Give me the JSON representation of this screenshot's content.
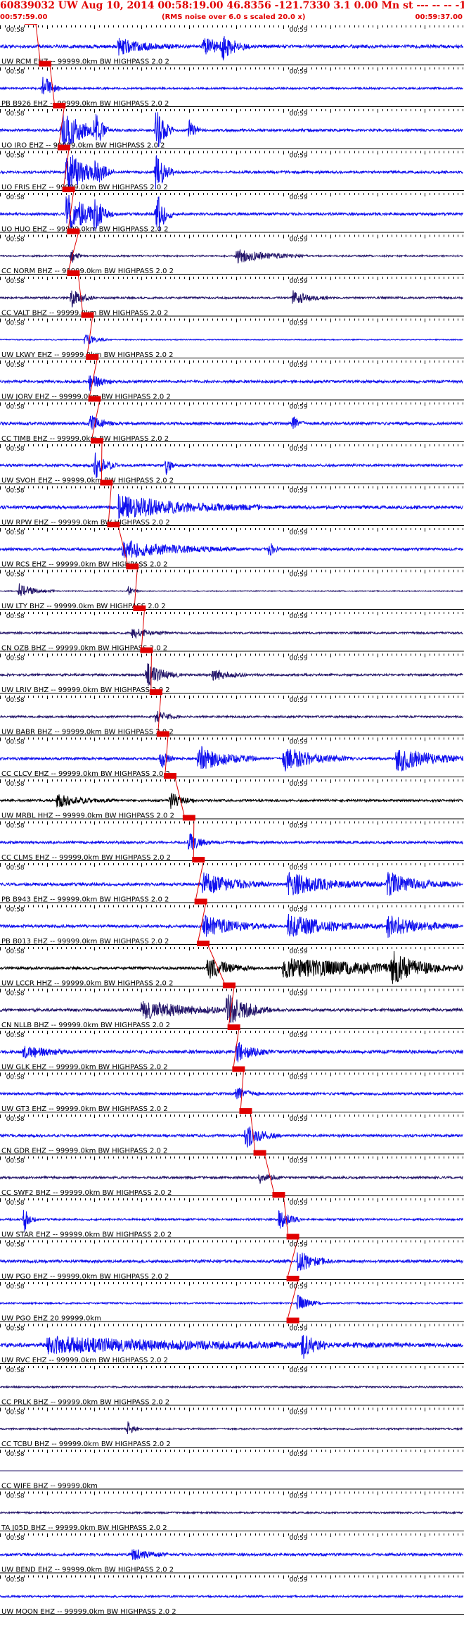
{
  "header": {
    "title": "60839032 UW Aug 10, 2014 00:58:19.00   46.8356 -121.7330  3.1 0.00 Mn st --- -- --  -1",
    "start_time": "00:57:59.00",
    "noise_note": "(RMS noise over 6.0 s scaled 20.0 x)",
    "end_time": "00:59:37.00"
  },
  "chart_data": {
    "type": "line",
    "title": "60839032 UW Aug 10, 2014 00:58:19.00   46.8356 -121.7330  3.1 0.00 Mn st --- -- --  -1",
    "x_range_seconds": [
      0,
      98
    ],
    "x_tick_labels": [
      "00:58",
      "00:59"
    ],
    "x_tick_seconds": [
      1,
      61
    ],
    "colors": {
      "red": "#e00000",
      "blue": "#1010ee",
      "navy": "#24166a",
      "black": "#000000"
    },
    "traces": [
      {
        "label": "UW RCM EHZ -- 99999.0km BW  HIGHPASS  2.0  2",
        "color": "blue",
        "pick_s": 5.5,
        "energy": 1.0,
        "bursts": [
          [
            25,
            5,
            1.4
          ],
          [
            43,
            4,
            1.6
          ],
          [
            47,
            2,
            2.0
          ]
        ]
      },
      {
        "label": "PB B926 EHZ -- 99999.0km BW  HIGHPASS  2.0  2",
        "color": "blue",
        "pick_s": 8.5,
        "energy": 0.6,
        "bursts": [
          [
            9,
            1.5,
            3.0
          ]
        ]
      },
      {
        "label": "UO IRO EHZ -- 99999.0km BW  HIGHPASS  2.0  2",
        "color": "blue",
        "pick_s": 11.5,
        "energy": 0.8,
        "bursts": [
          [
            13,
            4,
            4.0
          ],
          [
            20,
            1,
            3.5
          ],
          [
            33,
            1.5,
            4.5
          ],
          [
            40,
            1,
            2.0
          ]
        ]
      },
      {
        "label": "UO FRIS EHZ -- 99999.0km BW  HIGHPASS  2.0  2",
        "color": "blue",
        "pick_s": 12.5,
        "energy": 0.8,
        "bursts": [
          [
            14,
            4,
            4.0
          ],
          [
            20,
            1,
            3.0
          ],
          [
            33,
            1.5,
            4.5
          ]
        ]
      },
      {
        "label": "UO HUO EHZ -- 99999.0km BW  HIGHPASS  2.0  2",
        "color": "blue",
        "pick_s": 13.5,
        "energy": 0.8,
        "bursts": [
          [
            14,
            4,
            4.0
          ],
          [
            20,
            1,
            3.0
          ],
          [
            33,
            1.5,
            4.5
          ]
        ]
      },
      {
        "label": "CC NORM BHZ -- 99999.0km BW  HIGHPASS  2.0  2",
        "color": "navy",
        "pick_s": 14.5,
        "energy": 0.5,
        "bursts": [
          [
            15,
            1,
            1.5
          ],
          [
            50,
            6,
            1.3
          ]
        ]
      },
      {
        "label": "CC VALT BHZ -- 99999.0km BW  HIGHPASS  2.0  2",
        "color": "navy",
        "pick_s": 14.5,
        "energy": 0.6,
        "bursts": [
          [
            15,
            2,
            1.8
          ],
          [
            62,
            3,
            1.4
          ]
        ]
      },
      {
        "label": "UW LKWY EHZ -- 99999.0km BW  HIGHPASS  2.0  2",
        "color": "blue",
        "pick_s": 17.5,
        "energy": 0.3,
        "bursts": [
          [
            18,
            2,
            1.2
          ]
        ]
      },
      {
        "label": "UW JORV EHZ -- 99999.0km BW  HIGHPASS  2.0  2",
        "color": "blue",
        "pick_s": 18.5,
        "energy": 0.8,
        "bursts": [
          [
            19,
            2,
            1.5
          ]
        ]
      },
      {
        "label": "CC TIMB EHZ -- 99999.0km BW  HIGHPASS  2.0  2",
        "color": "blue",
        "pick_s": 19.0,
        "energy": 0.9,
        "bursts": [
          [
            19,
            2,
            1.6
          ],
          [
            62,
            1,
            1.5
          ]
        ]
      },
      {
        "label": "UW SVOH EHZ -- 99999.0km BW  HIGHPASS  2.0  2",
        "color": "blue",
        "pick_s": 19.5,
        "energy": 0.8,
        "bursts": [
          [
            20,
            2,
            2.5
          ],
          [
            35,
            1,
            1.8
          ]
        ]
      },
      {
        "label": "UW RPW EHZ -- 99999.0km BW  HIGHPASS  2.0  2",
        "color": "blue",
        "pick_s": 21.5,
        "energy": 1.0,
        "bursts": [
          [
            25,
            12,
            2.2
          ]
        ]
      },
      {
        "label": "UW RCS EHZ -- 99999.0km BW  HIGHPASS  2.0  2",
        "color": "blue",
        "pick_s": 23.0,
        "energy": 0.8,
        "bursts": [
          [
            26,
            10,
            1.6
          ],
          [
            57,
            1,
            1.4
          ]
        ]
      },
      {
        "label": "UW LTY BHZ -- 99999.0km BW  HIGHPASS  2.0  2",
        "color": "navy",
        "pick_s": 27.0,
        "energy": 0.3,
        "bursts": [
          [
            4,
            3,
            1.3
          ],
          [
            27,
            1,
            1.0
          ]
        ]
      },
      {
        "label": "CN OZB BHZ -- 99999.0km BW  HIGHPASS  2.0  2",
        "color": "navy",
        "pick_s": 28.5,
        "energy": 0.6,
        "bursts": [
          [
            28,
            3,
            1.0
          ]
        ]
      },
      {
        "label": "UW LRIV BHZ -- 99999.0km BW  HIGHPASS  2.0  2",
        "color": "navy",
        "pick_s": 30.0,
        "energy": 0.7,
        "bursts": [
          [
            31,
            3,
            2.2
          ],
          [
            45,
            3,
            1.2
          ]
        ]
      },
      {
        "label": "UW BABR BHZ -- 99999.0km BW  HIGHPASS  2.0  2",
        "color": "navy",
        "pick_s": 32.0,
        "energy": 0.6,
        "bursts": [
          [
            33,
            2,
            1.2
          ]
        ]
      },
      {
        "label": "CC CLCV EHZ -- 99999.0km BW  HIGHPASS  2.0  2",
        "color": "blue",
        "pick_s": 33.5,
        "energy": 0.8,
        "bursts": [
          [
            34,
            1,
            2.5
          ],
          [
            42,
            5,
            2.5
          ],
          [
            60,
            6,
            2.2
          ],
          [
            84,
            6,
            2.5
          ]
        ]
      },
      {
        "label": "UW MRBL HHZ -- 99999.0km BW  HIGHPASS  2.0  2",
        "color": "black",
        "pick_s": 35.0,
        "energy": 0.7,
        "bursts": [
          [
            12,
            5,
            1.1
          ],
          [
            36,
            2,
            1.6
          ]
        ]
      },
      {
        "label": "CC CLMS EHZ -- 99999.0km BW  HIGHPASS  2.0  2",
        "color": "blue",
        "pick_s": 39.0,
        "energy": 0.8,
        "bursts": [
          [
            40,
            2,
            1.6
          ]
        ]
      },
      {
        "label": "PB B943 EHZ -- 99999.0km BW  HIGHPASS  2.0  2",
        "color": "blue",
        "pick_s": 41.0,
        "energy": 0.9,
        "bursts": [
          [
            43,
            6,
            2.0
          ],
          [
            61,
            8,
            2.0
          ],
          [
            82,
            6,
            2.0
          ]
        ]
      },
      {
        "label": "PB B013 EHZ -- 99999.0km BW  HIGHPASS  2.0  2",
        "color": "blue",
        "pick_s": 41.5,
        "energy": 0.9,
        "bursts": [
          [
            43,
            6,
            2.0
          ],
          [
            61,
            8,
            2.0
          ],
          [
            82,
            6,
            2.0
          ]
        ]
      },
      {
        "label": "UW LCCR HHZ -- 99999.0km BW  HIGHPASS  2.0  2",
        "color": "black",
        "pick_s": 42.0,
        "energy": 0.8,
        "bursts": [
          [
            44,
            4,
            2.0
          ],
          [
            60,
            20,
            1.8
          ],
          [
            83,
            4,
            2.5
          ]
        ]
      },
      {
        "label": "CN NLLB BHZ -- 99999.0km BW  HIGHPASS  2.0  2",
        "color": "navy",
        "pick_s": 47.5,
        "energy": 0.9,
        "bursts": [
          [
            30,
            10,
            1.6
          ],
          [
            48,
            4,
            2.6
          ]
        ]
      },
      {
        "label": "UW GLK EHZ -- 99999.0km BW  HIGHPASS  2.0  2",
        "color": "blue",
        "pick_s": 48.5,
        "energy": 1.0,
        "bursts": [
          [
            5,
            4,
            1.2
          ],
          [
            50,
            3,
            1.8
          ]
        ]
      },
      {
        "label": "UW GT3 EHZ -- 99999.0km BW  HIGHPASS  2.0  2",
        "color": "blue",
        "pick_s": 49.5,
        "energy": 0.8,
        "bursts": [
          [
            50,
            2,
            1.4
          ]
        ]
      },
      {
        "label": "CN GDR EHZ -- 99999.0km BW  HIGHPASS  2.0  2",
        "color": "blue",
        "pick_s": 51.0,
        "energy": 0.8,
        "bursts": [
          [
            52,
            3,
            2.2
          ]
        ]
      },
      {
        "label": "CC SWF2 BHZ -- 99999.0km BW  HIGHPASS  2.0  2",
        "color": "navy",
        "pick_s": 54.0,
        "energy": 0.7,
        "bursts": [
          [
            55,
            2,
            1.0
          ]
        ]
      },
      {
        "label": "UW STAR EHZ -- 99999.0km BW  HIGHPASS  2.0  2",
        "color": "blue",
        "pick_s": 58.0,
        "energy": 0.6,
        "bursts": [
          [
            5,
            1,
            2.5
          ],
          [
            59,
            2,
            2.0
          ]
        ]
      },
      {
        "label": "UW PGO EHZ -- 99999.0km BW  HIGHPASS  2.0  2",
        "color": "blue",
        "pick_s": 61.0,
        "energy": 0.9,
        "bursts": [
          [
            63,
            3,
            2.0
          ]
        ]
      },
      {
        "label": "UW PGO EHZ 20 99999.0km",
        "color": "blue",
        "pick_s": 61.0,
        "energy": 0.5,
        "bursts": [
          [
            63,
            2,
            1.5
          ]
        ]
      },
      {
        "label": "UW RVC EHZ -- 99999.0km BW  HIGHPASS  2.0  2",
        "color": "blue",
        "pick_s": 61.0,
        "energy": 1.2,
        "bursts": [
          [
            10,
            30,
            1.4
          ],
          [
            64,
            2,
            2.4
          ]
        ]
      },
      {
        "label": "CC PRLK BHZ -- 99999.0km BW  HIGHPASS  2.0  2",
        "color": "navy",
        "pick_s": null,
        "energy": 0.5,
        "bursts": []
      },
      {
        "label": "CC TCBU BHZ -- 99999.0km BW  HIGHPASS  2.0  2",
        "color": "navy",
        "pick_s": null,
        "energy": 0.5,
        "bursts": [
          [
            27,
            1,
            1.4
          ]
        ]
      },
      {
        "label": "CC WIFE BHZ -- 99999.0km",
        "color": "navy",
        "pick_s": null,
        "energy": 0.0,
        "bursts": []
      },
      {
        "label": "TA J05D BHZ -- 99999.0km BW  HIGHPASS  2.0  2",
        "color": "navy",
        "pick_s": null,
        "energy": 0.5,
        "bursts": []
      },
      {
        "label": "UW BEND EHZ -- 99999.0km BW  HIGHPASS  2.0  2",
        "color": "blue",
        "pick_s": null,
        "energy": 0.8,
        "bursts": [
          [
            28,
            3,
            1.2
          ]
        ]
      },
      {
        "label": "UW MOON EHZ -- 99999.0km BW  HIGHPASS  2.0  2",
        "color": "blue",
        "pick_s": null,
        "energy": 0.6,
        "bursts": []
      }
    ]
  }
}
